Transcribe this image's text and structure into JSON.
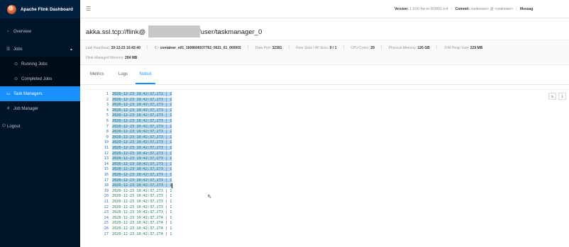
{
  "brand": {
    "title": "Apache Flink Dashboard"
  },
  "menu": [
    {
      "label": "Overview",
      "icon": "dashboard-icon"
    },
    {
      "label": "Jobs",
      "icon": "list-icon"
    },
    {
      "label": "Running Jobs",
      "icon": "play-circle-icon"
    },
    {
      "label": "Completed Jobs",
      "icon": "check-circle-icon"
    },
    {
      "label": "Task Managers",
      "icon": "task-manager-icon"
    },
    {
      "label": "Job Manager",
      "icon": "cluster-icon"
    },
    {
      "label": "Logout",
      "icon": "logout-icon"
    }
  ],
  "header": {
    "version_label": "Version:",
    "version_value": "1.10.0-hw-ei-303001-rc4",
    "commit_label": "Commit:",
    "commit_value": "<unknown> @ <unknown>",
    "message_label": "Messag"
  },
  "taskmanager": {
    "title_prefix": "akka.ssl.tcp://flink@",
    "title_suffix": "/user/taskmanager_0",
    "heartbeat_label": "Last Heartbeat:",
    "heartbeat_value": "20-12-23 10:42:40",
    "id_label": "ID:",
    "id_value": "container_e01_1608606937762_0021_01_000002",
    "data_port_label": "Data Port:",
    "data_port_value": "32391",
    "slots_label": "Free Slots / All Slots:",
    "slots_value": "0 / 1",
    "cpu_label": "CPU Cores:",
    "cpu_value": "29",
    "phys_mem_label": "Physical Memory:",
    "phys_mem_value": "126 GB",
    "heap_label": "JVM Heap Size:",
    "heap_value": "229 MB",
    "managed_label": "Flink Managed Memory:",
    "managed_value": "294 MB"
  },
  "tabs": [
    "Metrics",
    "Logs",
    "Stdout"
  ],
  "active_tab": "Stdout",
  "toolbar": {
    "reload_icon": "reload-icon",
    "download_icon": "download-icon"
  },
  "log_lines": [
    {
      "n": "1",
      "text": "2020-12-23 10:42:37,272 | 1"
    },
    {
      "n": "2",
      "text": "2020-12-23 10:42:37,273 | 1"
    },
    {
      "n": "3",
      "text": "2020-12-23 10:42:37,273 | 1"
    },
    {
      "n": "4",
      "text": "2020-12-23 10:42:37,273 | 1"
    },
    {
      "n": "5",
      "text": "2020-12-23 10:42:37,273 | 1"
    },
    {
      "n": "6",
      "text": "2020-12-23 10:42:37,273 | 1"
    },
    {
      "n": "7",
      "text": "2020-12-23 10:42:37,273 | 1"
    },
    {
      "n": "8",
      "text": "2020-12-23 10:42:37,273 | 1"
    },
    {
      "n": "9",
      "text": "2020-12-23 10:42:37,273 | 1"
    },
    {
      "n": "10",
      "text": "2020-12-23 10:42:37,273 | 1"
    },
    {
      "n": "11",
      "text": "2020-12-23 10:42:37,273 | 1"
    },
    {
      "n": "12",
      "text": "2020-12-23 10:42:37,273 | 1"
    },
    {
      "n": "13",
      "text": "2020-12-23 10:42:37,273 | 1"
    },
    {
      "n": "14",
      "text": "2020-12-23 10:42:37,273 | 1"
    },
    {
      "n": "15",
      "text": "2020-12-23 10:42:37,273 | 1"
    },
    {
      "n": "16",
      "text": "2020-12-23 10:42:37,273 | 1"
    },
    {
      "n": "17",
      "text": "2020-12-23 10:42:37,273 | 1"
    },
    {
      "n": "18",
      "text": "2020-12-23 10:42:37,273 | 1"
    },
    {
      "n": "19",
      "text": "2020-12-23 10:42:37,273 | 1"
    },
    {
      "n": "20",
      "text": "2020-12-23 10:42:37,273 | 1"
    },
    {
      "n": "21",
      "text": "2020-12-23 10:42:37,273 | 1"
    },
    {
      "n": "22",
      "text": "2020-12-23 10:42:37,273 | 1"
    },
    {
      "n": "23",
      "text": "2020-12-23 10:42:37,273 | 1"
    },
    {
      "n": "24",
      "text": "2020-12-23 10:42:37,274 | 1"
    },
    {
      "n": "25",
      "text": "2020-12-23 10:42:37,274 | 1"
    },
    {
      "n": "26",
      "text": "2020-12-23 10:42:37,274 | 1"
    },
    {
      "n": "27",
      "text": "2020-12-23 10:42:37,274 | 1"
    }
  ],
  "selected_lines": 17,
  "cursor_line": 18
}
